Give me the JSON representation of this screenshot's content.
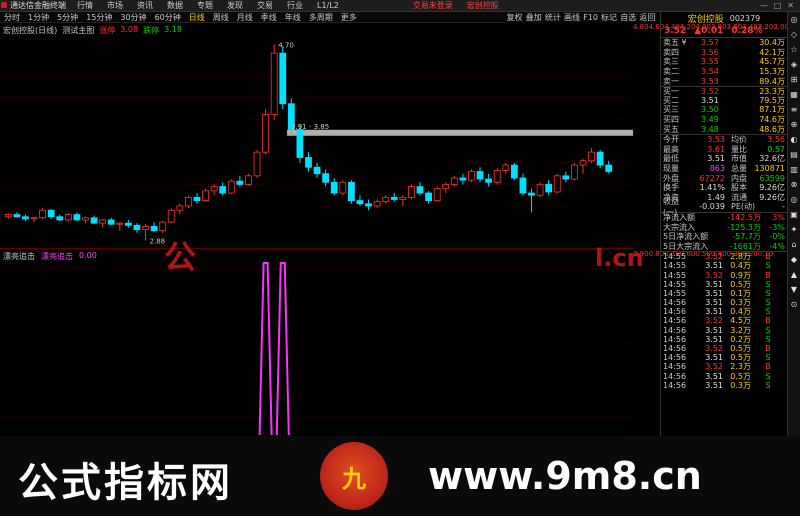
{
  "topbar": {
    "app": "通达信金融终端",
    "menu": [
      "行情",
      "市场",
      "资讯",
      "数据",
      "专题",
      "发现",
      "交易",
      "行业",
      "L1/L2"
    ],
    "alert1": "交易未登录",
    "alert2": "宏创控股",
    "win": [
      "—",
      "□",
      "✕"
    ]
  },
  "toolbar": {
    "periods": [
      "分时",
      "1分钟",
      "5分钟",
      "15分钟",
      "30分钟",
      "60分钟",
      "日线",
      "周线",
      "月线",
      "季线",
      "年线",
      "多周期",
      "更多"
    ],
    "active": "日线",
    "right": [
      "复权",
      "叠加",
      "统计",
      "画线",
      "F10",
      "标记",
      "自选",
      "返回"
    ]
  },
  "main": {
    "title": "宏创控股(日线)",
    "formula": "测试主图",
    "rise_label": "涨停",
    "rise_val": "3.08",
    "fall_label": "跌停",
    "fall_val": "3.18",
    "peak_label": "4.70",
    "range_label": "3.91 - 3.85",
    "low_label": "2.88"
  },
  "sub": {
    "title": "漂亮追击",
    "series": "漂亮追击",
    "value": "0.00"
  },
  "yaxis_main": [
    "4.80",
    "4.60",
    "4.40",
    "4.20",
    "4.00",
    "3.80",
    "3.60",
    "3.40",
    "3.20",
    "3.00"
  ],
  "yaxis_sub": [
    "0.90",
    "0.80",
    "0.70",
    "0.60",
    "0.50",
    "0.40",
    "0.30",
    "0.20",
    "0.10"
  ],
  "chart_data": {
    "type": "candlestick",
    "candles": [
      [
        3.1,
        3.13,
        3.08,
        3.12
      ],
      [
        3.12,
        3.14,
        3.09,
        3.1
      ],
      [
        3.1,
        3.12,
        3.06,
        3.08
      ],
      [
        3.08,
        3.1,
        3.05,
        3.09
      ],
      [
        3.09,
        3.18,
        3.08,
        3.16
      ],
      [
        3.16,
        3.17,
        3.08,
        3.1
      ],
      [
        3.1,
        3.12,
        3.06,
        3.07
      ],
      [
        3.07,
        3.13,
        3.06,
        3.12
      ],
      [
        3.12,
        3.14,
        3.06,
        3.07
      ],
      [
        3.07,
        3.1,
        3.04,
        3.09
      ],
      [
        3.09,
        3.11,
        3.03,
        3.04
      ],
      [
        3.04,
        3.08,
        3.0,
        3.07
      ],
      [
        3.07,
        3.09,
        3.02,
        3.03
      ],
      [
        3.03,
        3.05,
        2.97,
        3.04
      ],
      [
        3.04,
        3.07,
        3.0,
        3.02
      ],
      [
        3.02,
        3.04,
        2.95,
        2.98
      ],
      [
        2.98,
        3.03,
        2.88,
        3.01
      ],
      [
        3.01,
        3.05,
        2.96,
        2.97
      ],
      [
        2.97,
        3.06,
        2.95,
        3.05
      ],
      [
        3.05,
        3.18,
        3.04,
        3.16
      ],
      [
        3.16,
        3.22,
        3.12,
        3.2
      ],
      [
        3.2,
        3.3,
        3.18,
        3.28
      ],
      [
        3.28,
        3.32,
        3.22,
        3.25
      ],
      [
        3.25,
        3.36,
        3.24,
        3.34
      ],
      [
        3.34,
        3.4,
        3.3,
        3.38
      ],
      [
        3.38,
        3.42,
        3.3,
        3.32
      ],
      [
        3.32,
        3.45,
        3.31,
        3.43
      ],
      [
        3.43,
        3.48,
        3.38,
        3.4
      ],
      [
        3.4,
        3.5,
        3.39,
        3.48
      ],
      [
        3.48,
        3.72,
        3.46,
        3.7
      ],
      [
        3.7,
        4.1,
        3.68,
        4.05
      ],
      [
        4.05,
        4.7,
        4.0,
        4.62
      ],
      [
        4.62,
        4.68,
        4.1,
        4.15
      ],
      [
        4.15,
        4.2,
        3.85,
        3.91
      ],
      [
        3.91,
        3.95,
        3.6,
        3.65
      ],
      [
        3.65,
        3.7,
        3.52,
        3.56
      ],
      [
        3.56,
        3.6,
        3.46,
        3.5
      ],
      [
        3.5,
        3.54,
        3.38,
        3.42
      ],
      [
        3.42,
        3.46,
        3.3,
        3.32
      ],
      [
        3.32,
        3.44,
        3.3,
        3.42
      ],
      [
        3.42,
        3.44,
        3.22,
        3.25
      ],
      [
        3.25,
        3.3,
        3.2,
        3.22
      ],
      [
        3.22,
        3.26,
        3.16,
        3.2
      ],
      [
        3.2,
        3.26,
        3.18,
        3.24
      ],
      [
        3.24,
        3.3,
        3.22,
        3.28
      ],
      [
        3.28,
        3.32,
        3.24,
        3.26
      ],
      [
        3.26,
        3.3,
        3.2,
        3.28
      ],
      [
        3.28,
        3.4,
        3.26,
        3.38
      ],
      [
        3.38,
        3.42,
        3.3,
        3.32
      ],
      [
        3.32,
        3.34,
        3.22,
        3.25
      ],
      [
        3.25,
        3.38,
        3.24,
        3.36
      ],
      [
        3.36,
        3.42,
        3.32,
        3.4
      ],
      [
        3.4,
        3.48,
        3.38,
        3.46
      ],
      [
        3.46,
        3.5,
        3.4,
        3.44
      ],
      [
        3.44,
        3.54,
        3.42,
        3.52
      ],
      [
        3.52,
        3.56,
        3.42,
        3.45
      ],
      [
        3.45,
        3.5,
        3.38,
        3.42
      ],
      [
        3.42,
        3.55,
        3.4,
        3.53
      ],
      [
        3.53,
        3.6,
        3.5,
        3.58
      ],
      [
        3.58,
        3.6,
        3.44,
        3.46
      ],
      [
        3.46,
        3.5,
        3.3,
        3.32
      ],
      [
        3.32,
        3.36,
        3.14,
        3.3
      ],
      [
        3.3,
        3.42,
        3.28,
        3.4
      ],
      [
        3.4,
        3.44,
        3.3,
        3.33
      ],
      [
        3.33,
        3.5,
        3.32,
        3.48
      ],
      [
        3.48,
        3.52,
        3.42,
        3.45
      ],
      [
        3.45,
        3.6,
        3.44,
        3.58
      ],
      [
        3.58,
        3.64,
        3.5,
        3.62
      ],
      [
        3.62,
        3.74,
        3.6,
        3.7
      ],
      [
        3.7,
        3.72,
        3.55,
        3.58
      ],
      [
        3.58,
        3.62,
        3.5,
        3.52
      ]
    ],
    "ylim": [
      2.8,
      4.9
    ],
    "overlay_price": 3.88,
    "signal_ylim": [
      0,
      1
    ],
    "signal_spikes": [
      0.42,
      0.45
    ]
  },
  "stock": {
    "name": "宏创控股",
    "code": "002379",
    "price": "3.52",
    "change": "▲0.01",
    "pct": "0.28%"
  },
  "orderbook": [
    {
      "label": "卖五 ¥",
      "price": "3.57",
      "vol": "30.4万",
      "c": "r"
    },
    {
      "label": "卖四",
      "price": "3.56",
      "vol": "42.1万",
      "c": "r"
    },
    {
      "label": "卖三",
      "price": "3.55",
      "vol": "45.7万",
      "c": "r"
    },
    {
      "label": "卖二",
      "price": "3.54",
      "vol": "15.3万",
      "c": "r"
    },
    {
      "label": "卖一",
      "price": "3.53",
      "vol": "89.4万",
      "c": "r"
    },
    {
      "label": "买一",
      "price": "3.52",
      "vol": "23.3万",
      "c": "r"
    },
    {
      "label": "买二",
      "price": "3.51",
      "vol": "79.5万",
      "c": "w"
    },
    {
      "label": "买三",
      "price": "3.50",
      "vol": "87.1万",
      "c": "g"
    },
    {
      "label": "买四",
      "price": "3.49",
      "vol": "74.6万",
      "c": "g"
    },
    {
      "label": "买五",
      "price": "3.48",
      "vol": "48.6万",
      "c": "g"
    }
  ],
  "stats": [
    {
      "k": "今开",
      "v": "3.53",
      "vc": "r",
      "k2": "均价",
      "v2": "3.56",
      "v2c": "r"
    },
    {
      "k": "最高",
      "v": "3.61",
      "vc": "r",
      "k2": "量比",
      "v2": "0.57",
      "v2c": "g"
    },
    {
      "k": "最低",
      "v": "3.51",
      "vc": "w",
      "k2": "市值",
      "v2": "32.6亿",
      "v2c": "w"
    },
    {
      "k": "现量",
      "v": "863",
      "vc": "m",
      "k2": "总量",
      "v2": "130871",
      "v2c": "y"
    },
    {
      "k": "外盘",
      "v": "67272",
      "vc": "r",
      "k2": "内盘",
      "v2": "63599",
      "v2c": "g"
    },
    {
      "k": "换手",
      "v": "1.41%",
      "vc": "w",
      "k2": "股本",
      "v2": "9.26亿",
      "v2c": "w"
    },
    {
      "k": "净资",
      "v": "1.49",
      "vc": "w",
      "k2": "流通",
      "v2": "9.26亿",
      "v2c": "w"
    },
    {
      "k": "收益(一)",
      "v": "-0.039",
      "vc": "w",
      "k2": "PE(动)",
      "v2": "-",
      "v2c": "w"
    }
  ],
  "flows": [
    {
      "k": "净流入额",
      "v": "-142.5万",
      "p": "3%",
      "c": "r"
    },
    {
      "k": "大宗流入",
      "v": "-125.3万",
      "p": "-3%",
      "c": "g"
    },
    {
      "k": "5日净流入额",
      "v": "-57.7万",
      "p": "-0%",
      "c": "g"
    },
    {
      "k": "5日大宗流入",
      "v": "-1661万",
      "p": "-4%",
      "c": "g"
    }
  ],
  "ticks": [
    {
      "t": "14:55",
      "p": "3.52",
      "pc": "r",
      "q": "2.8万",
      "s": "B",
      "sc": "r"
    },
    {
      "t": "14:55",
      "p": "3.51",
      "pc": "w",
      "q": "0.4万",
      "s": "S",
      "sc": "g"
    },
    {
      "t": "14:55",
      "p": "3.52",
      "pc": "r",
      "q": "0.9万",
      "s": "B",
      "sc": "r"
    },
    {
      "t": "14:55",
      "p": "3.51",
      "pc": "w",
      "q": "0.5万",
      "s": "S",
      "sc": "g"
    },
    {
      "t": "14:55",
      "p": "3.51",
      "pc": "w",
      "q": "0.1万",
      "s": "S",
      "sc": "g"
    },
    {
      "t": "14:56",
      "p": "3.51",
      "pc": "w",
      "q": "0.3万",
      "s": "S",
      "sc": "g"
    },
    {
      "t": "14:56",
      "p": "3.51",
      "pc": "w",
      "q": "0.4万",
      "s": "S",
      "sc": "g"
    },
    {
      "t": "14:56",
      "p": "3.52",
      "pc": "r",
      "q": "4.5万",
      "s": "B",
      "sc": "r"
    },
    {
      "t": "14:56",
      "p": "3.51",
      "pc": "w",
      "q": "3.2万",
      "s": "S",
      "sc": "g"
    },
    {
      "t": "14:56",
      "p": "3.51",
      "pc": "w",
      "q": "0.2万",
      "s": "S",
      "sc": "g"
    },
    {
      "t": "14:56",
      "p": "3.52",
      "pc": "r",
      "q": "0.5万",
      "s": "B",
      "sc": "r"
    },
    {
      "t": "14:56",
      "p": "3.51",
      "pc": "w",
      "q": "0.5万",
      "s": "S",
      "sc": "g"
    },
    {
      "t": "14:56",
      "p": "3.52",
      "pc": "r",
      "q": "2.3万",
      "s": "B",
      "sc": "r"
    },
    {
      "t": "14:56",
      "p": "3.51",
      "pc": "w",
      "q": "0.5万",
      "s": "S",
      "sc": "g"
    },
    {
      "t": "14:56",
      "p": "3.51",
      "pc": "w",
      "q": "0.3万",
      "s": "S",
      "sc": "g"
    }
  ],
  "side": [
    "◎",
    "◇",
    "☆",
    "◈",
    "⊞",
    "▦",
    "≡",
    "⊕",
    "◐",
    "▤",
    "▥",
    "⊗",
    "◎",
    "▣",
    "✦",
    "⌂",
    "◆",
    "▲",
    "▼",
    "⊙"
  ],
  "watermark": {
    "left": "公",
    "right": "l.cn"
  },
  "banner": {
    "left": "公式指标网",
    "right": "www.9m8.cn",
    "logo": "九"
  }
}
